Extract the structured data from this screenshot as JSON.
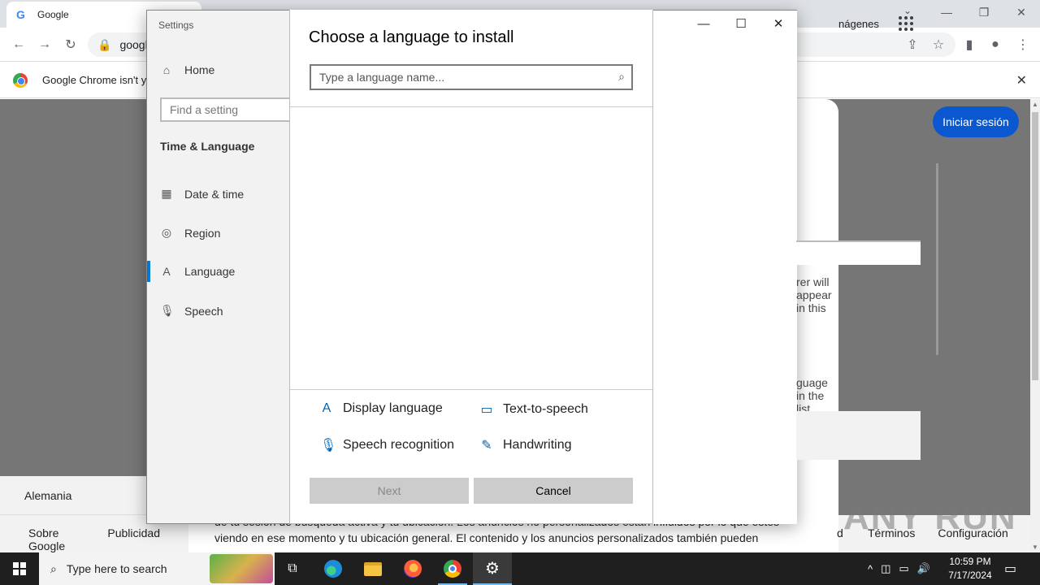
{
  "browser": {
    "tab_title": "Google",
    "url": "google",
    "infobar_text": "Google Chrome isn't y",
    "window_controls": [
      "—",
      "❐",
      "✕"
    ]
  },
  "google_page": {
    "images_link": "nágenes",
    "signin_label": "Iniciar sesión",
    "country": "Alemania",
    "footer_left": [
      "Sobre Google",
      "Publicidad"
    ],
    "footer_right": [
      "Términos",
      "Configuración"
    ],
    "footer_right_prefix": "d",
    "consent_lines": [
      "de tu sesión de búsqueda activa y tu ubicación. Los anuncios no personalizados están influidos por lo que estés",
      "viendo en ese momento y tu ubicación general. El contenido y los anuncios personalizados también pueden"
    ]
  },
  "settings": {
    "window_title": "Settings",
    "nav_home": "Home",
    "find_placeholder": "Find a setting",
    "section_title": "Time & Language",
    "nav_items": [
      "Date & time",
      "Region",
      "Language",
      "Speech"
    ],
    "bg_text_1": "rer will appear in this",
    "bg_text_2": "guage in the list that"
  },
  "dialog": {
    "title": "Choose a language to install",
    "search_placeholder": "Type a language name...",
    "features": {
      "display_language": "Display language",
      "text_to_speech": "Text-to-speech",
      "speech_recognition": "Speech recognition",
      "handwriting": "Handwriting"
    },
    "next_label": "Next",
    "cancel_label": "Cancel"
  },
  "taskbar": {
    "search_placeholder": "Type here to search",
    "time": "10:59 PM",
    "date": "7/17/2024"
  },
  "watermark": "ANY RUN"
}
